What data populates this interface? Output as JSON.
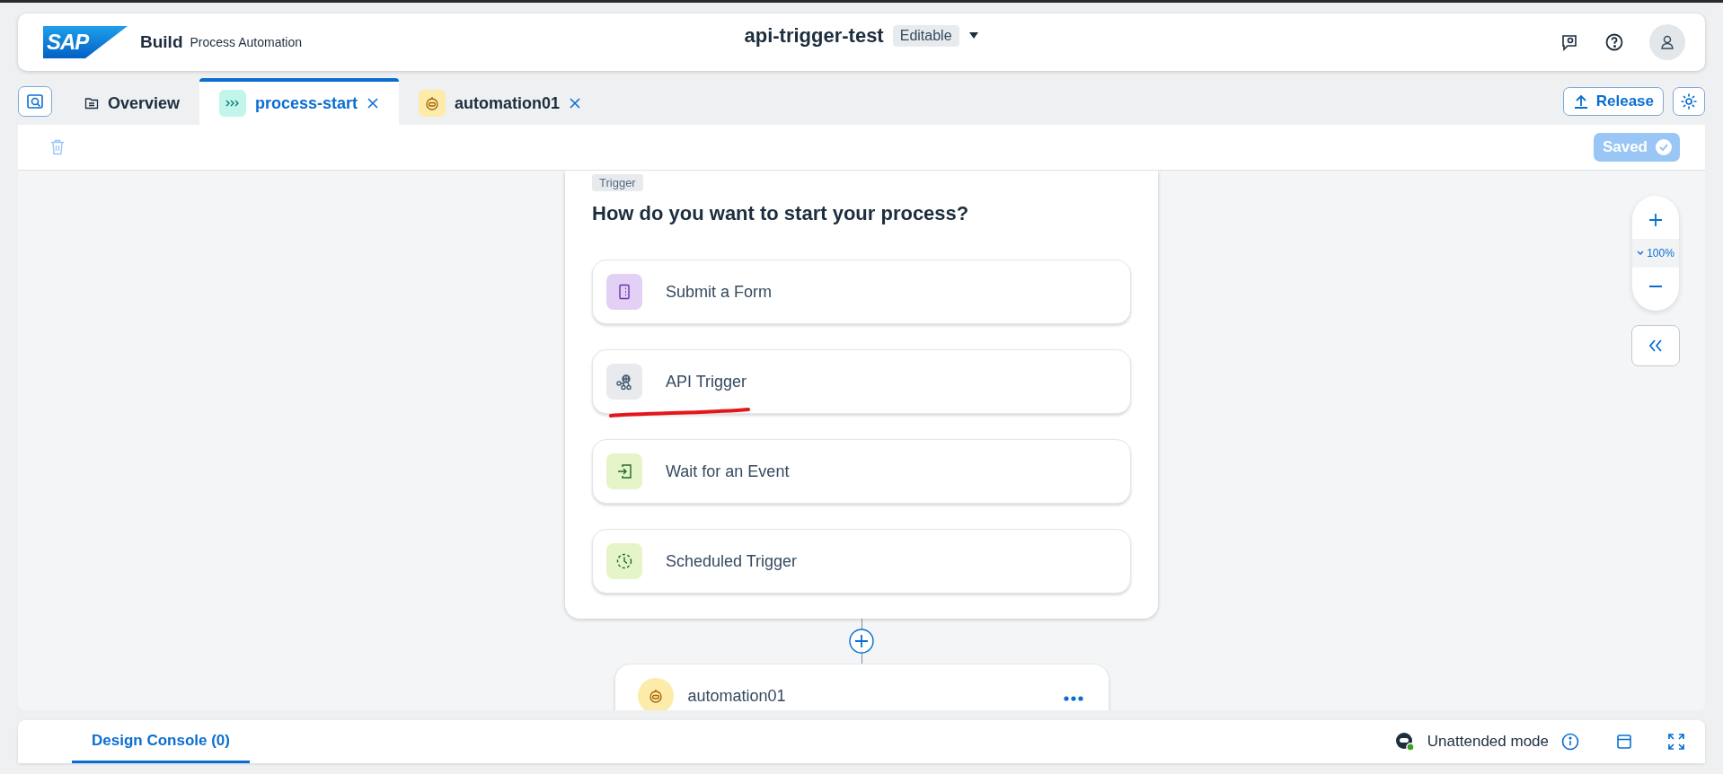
{
  "header": {
    "logo": "SAP",
    "brand": "Build",
    "product": "Process Automation",
    "title": "api-trigger-test",
    "status": "Editable"
  },
  "tabs": [
    {
      "label": "Overview",
      "kind": "overview",
      "selected": false,
      "closable": false
    },
    {
      "label": "process-start",
      "kind": "process",
      "selected": true,
      "closable": true
    },
    {
      "label": "automation01",
      "kind": "automation",
      "selected": false,
      "closable": true
    }
  ],
  "release_button": "Release",
  "toolbar": {
    "saved": "Saved"
  },
  "trigger_card": {
    "tag": "Trigger",
    "question": "How do you want to start your process?",
    "options": [
      {
        "label": "Submit a Form",
        "kind": "form"
      },
      {
        "label": "API Trigger",
        "kind": "api"
      },
      {
        "label": "Wait for an Event",
        "kind": "event"
      },
      {
        "label": "Scheduled Trigger",
        "kind": "schedule"
      }
    ]
  },
  "automation_step": {
    "label": "automation01"
  },
  "zoom": {
    "level_text": "100%"
  },
  "console": {
    "tab": "Design Console (0)",
    "mode": "Unattended mode"
  }
}
